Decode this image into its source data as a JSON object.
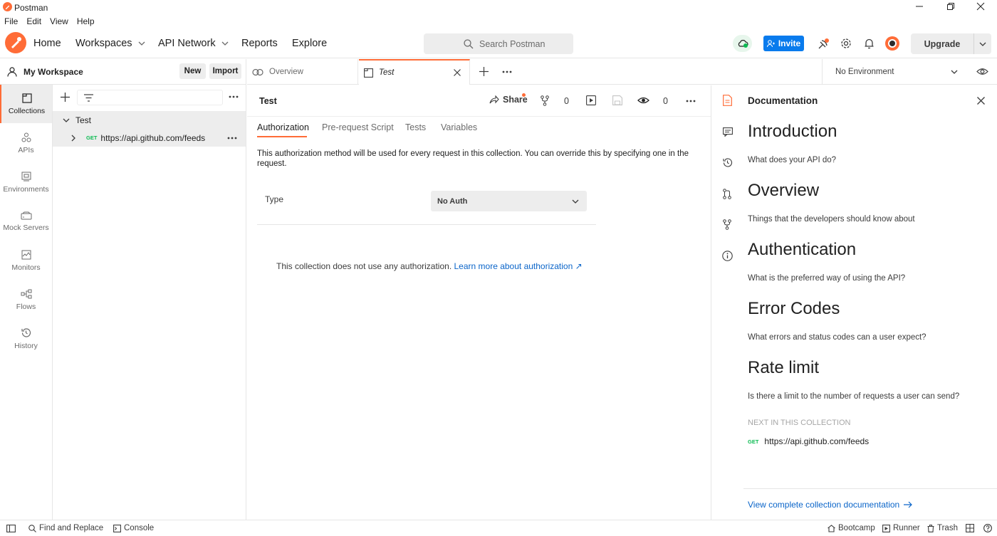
{
  "app": {
    "title": "Postman"
  },
  "menu": [
    "File",
    "Edit",
    "View",
    "Help"
  ],
  "header": {
    "home": "Home",
    "workspaces": "Workspaces",
    "api_network": "API Network",
    "reports": "Reports",
    "explore": "Explore",
    "search_placeholder": "Search Postman",
    "invite": "Invite",
    "upgrade": "Upgrade"
  },
  "workspace": {
    "name": "My Workspace",
    "new": "New",
    "import": "Import"
  },
  "rail": {
    "collections": "Collections",
    "apis": "APIs",
    "environments": "Environments",
    "mock_servers": "Mock Servers",
    "monitors": "Monitors",
    "flows": "Flows",
    "history": "History"
  },
  "tree": {
    "collection": "Test",
    "request_method": "GET",
    "request_url": "https://api.github.com/feeds"
  },
  "tabs": {
    "overview": "Overview",
    "test": "Test"
  },
  "environment": {
    "selected": "No Environment"
  },
  "main": {
    "title": "Test",
    "share": "Share",
    "fork_count": "0",
    "watch_count": "0",
    "subtabs": [
      "Authorization",
      "Pre-request Script",
      "Tests",
      "Variables"
    ],
    "auth_description": "This authorization method will be used for every request in this collection. You can override this by specifying one in the request.",
    "type_label": "Type",
    "type_value": "No Auth",
    "no_auth_message": "This collection does not use any authorization.",
    "learn_more": "Learn more about authorization ↗"
  },
  "docs": {
    "heading": "Documentation",
    "sections": [
      {
        "title": "Introduction",
        "text": "What does your API do?"
      },
      {
        "title": "Overview",
        "text": "Things that the developers should know about"
      },
      {
        "title": "Authentication",
        "text": "What is the preferred way of using the API?"
      },
      {
        "title": "Error Codes",
        "text": "What errors and status codes can a user expect?"
      },
      {
        "title": "Rate limit",
        "text": "Is there a limit to the number of requests a user can send?"
      }
    ],
    "next_label": "NEXT IN THIS COLLECTION",
    "next_method": "GET",
    "next_url": "https://api.github.com/feeds",
    "view_complete": "View complete collection documentation"
  },
  "status": {
    "find_replace": "Find and Replace",
    "console": "Console",
    "bootcamp": "Bootcamp",
    "runner": "Runner",
    "trash": "Trash"
  },
  "colors": {
    "brand": "#ff6c37",
    "accent": "#097bed",
    "get": "#0cbb52"
  }
}
